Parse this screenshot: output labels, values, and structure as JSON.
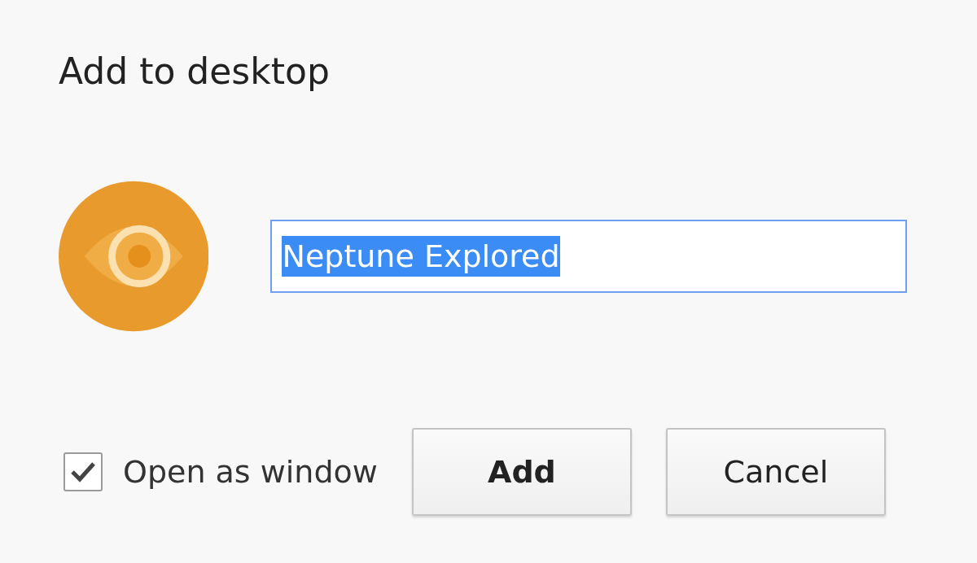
{
  "dialog": {
    "title": "Add to desktop"
  },
  "name_field": {
    "value": "Neptune Explored",
    "text_selected": true
  },
  "open_as_window": {
    "label": "Open as window",
    "checked": true
  },
  "buttons": [
    {
      "label": "Add",
      "kind": "default"
    },
    {
      "label": "Cancel",
      "kind": "normal"
    }
  ]
}
